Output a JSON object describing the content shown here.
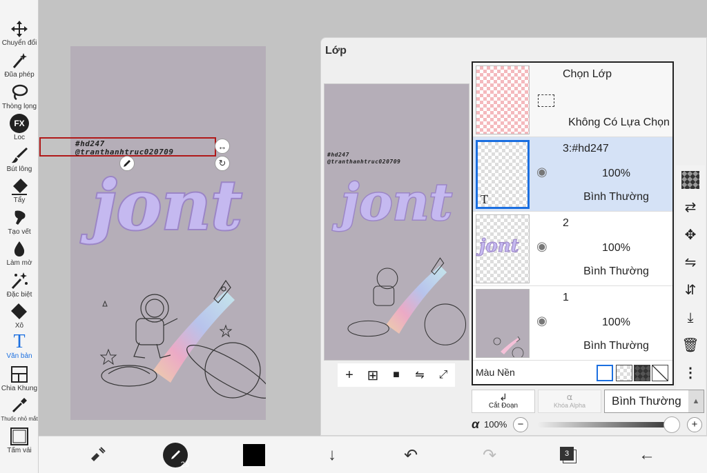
{
  "toolbar": {
    "tools": [
      {
        "label": "Chuyển đổi",
        "icon": "move-arrows-icon"
      },
      {
        "label": "Đũa phép",
        "icon": "magic-wand-icon"
      },
      {
        "label": "Thòng lọng",
        "icon": "lasso-icon"
      },
      {
        "label": "Loc",
        "icon": "fx-filter-icon",
        "glyph": "FX"
      },
      {
        "label": "Bút lông",
        "icon": "brush-icon"
      },
      {
        "label": "Tẩy",
        "icon": "eraser-icon"
      },
      {
        "label": "Tạo vết",
        "icon": "smudge-icon"
      },
      {
        "label": "Làm mờ",
        "icon": "blur-drop-icon"
      },
      {
        "label": "Đặc biệt",
        "icon": "special-sparkle-icon"
      },
      {
        "label": "Xô",
        "icon": "bucket-icon"
      },
      {
        "label": "Văn bản",
        "icon": "text-tool-icon",
        "glyph": "T"
      },
      {
        "label": "Chia Khung",
        "icon": "frame-divider-icon"
      },
      {
        "label": "Thuốc nhỏ mắt",
        "icon": "eyedropper-icon"
      },
      {
        "label": "Tấm vải",
        "icon": "canvas-icon"
      }
    ],
    "active_color": "#1b6fe0"
  },
  "canvas": {
    "watermark_line1": "#hd247",
    "watermark_line2": "@tranthanhtruc020709",
    "lettering": "jont",
    "background_color": "#b5aeb8",
    "lettering_color": "#c5b9f0"
  },
  "layer_panel": {
    "title": "Lớp",
    "selection_layer": {
      "name": "Chọn Lớp",
      "status": "Không Có Lựa Chọn"
    },
    "layers": [
      {
        "name": "3:#hd247",
        "opacity": "100%",
        "blend": "Bình Thường",
        "selected": true,
        "thumb_glyph": "T"
      },
      {
        "name": "2",
        "opacity": "100%",
        "blend": "Bình Thường",
        "selected": false
      },
      {
        "name": "1",
        "opacity": "100%",
        "blend": "Bình Thường",
        "selected": false
      }
    ],
    "background_label": "Màu Nền",
    "cut_label": "Cắt Đoạn",
    "alpha_lock_label": "Khóa Alpha",
    "blend_mode": "Bình Thường",
    "alpha_symbol": "α",
    "alpha_value": "100%",
    "opacity_fraction": 1.0,
    "selected_color": "#d5e2f6"
  },
  "bottombar": {
    "brush_size": "25",
    "layer_count": "3",
    "current_color": "#000000"
  }
}
